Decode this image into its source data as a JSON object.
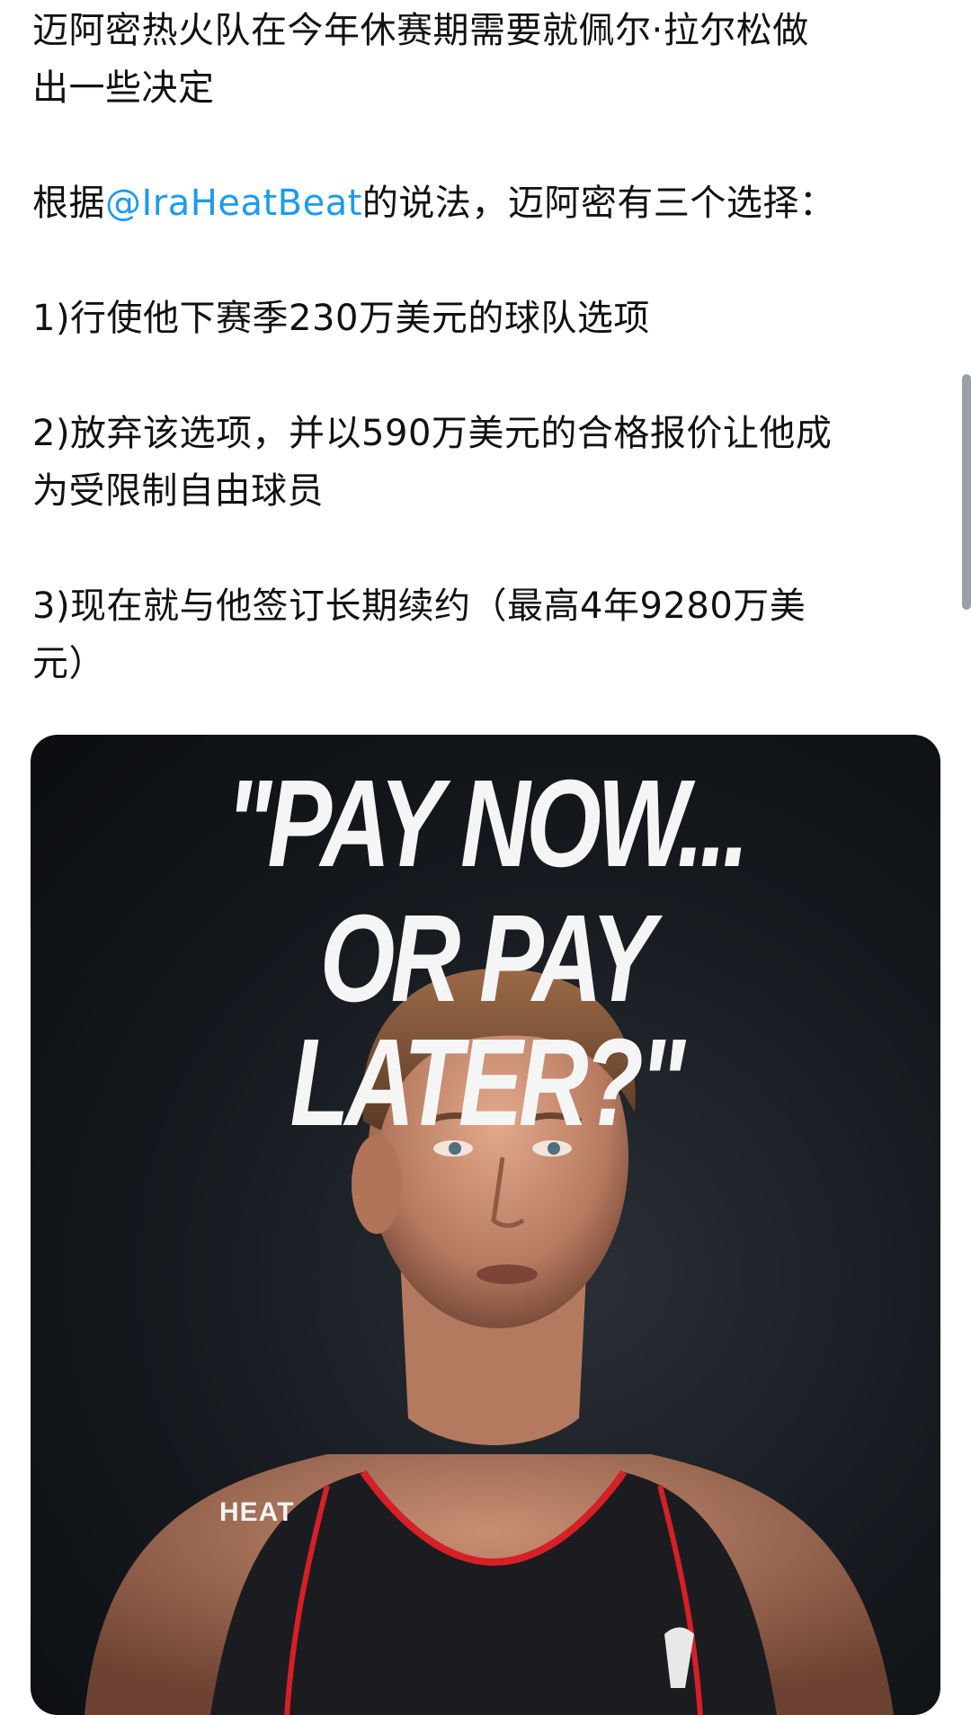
{
  "post": {
    "line_1": "迈阿密热火队在今年休赛期需要就佩尔·拉尔松做",
    "line_2": "出一些决定",
    "line_3_before": "根据",
    "mention": "@IraHeatBeat",
    "line_3_after": "的说法，迈阿密有三个选择：",
    "line_4": "1)行使他下赛季230万美元的球队选项",
    "line_5": "2)放弃该选项，并以590万美元的合格报价让他成",
    "line_6": "为受限制自由球员",
    "line_7": "3)现在就与他签订长期续约（最高4年9280万美",
    "line_8": "元）"
  },
  "image": {
    "headline_1": "\"PAY NOW...",
    "headline_2": "OR PAY LATER?\"",
    "watermark": "HEAT",
    "jersey_color": "#1b1c1f",
    "jersey_trim_color": "#d61f26"
  }
}
